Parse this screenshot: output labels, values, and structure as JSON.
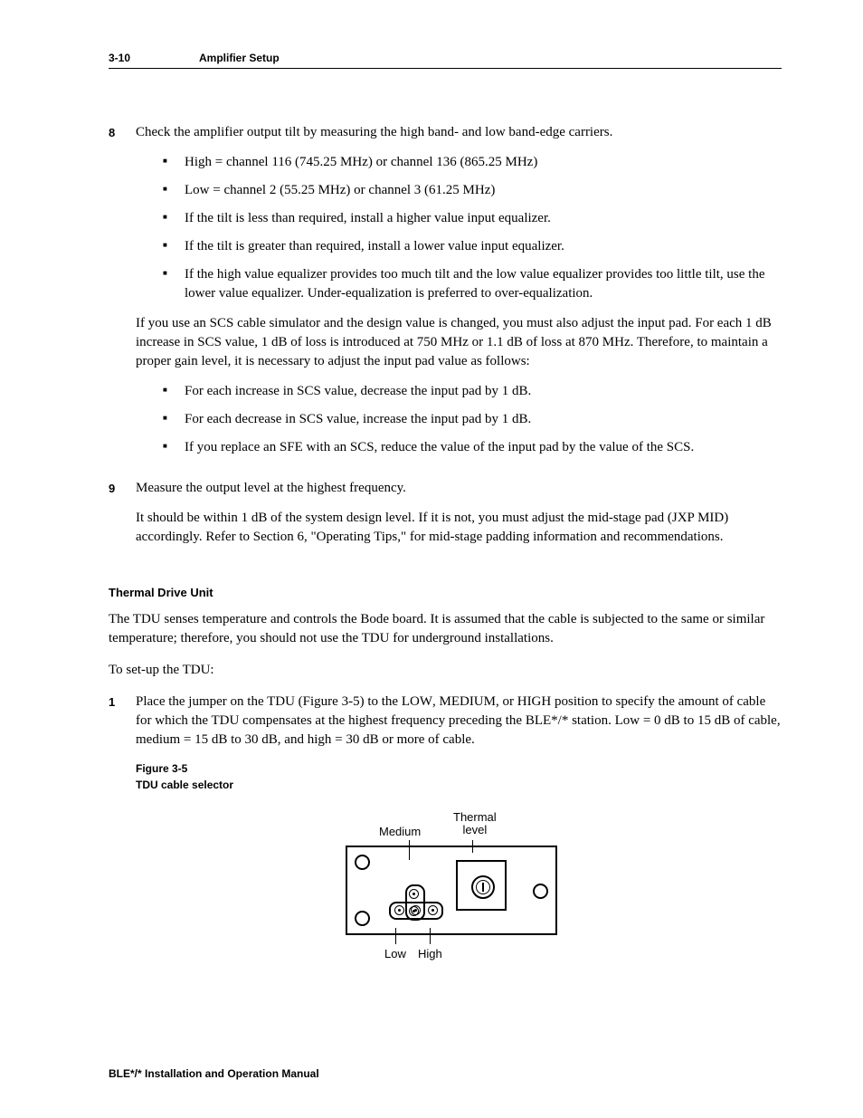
{
  "header": {
    "page_num": "3-10",
    "section_title": "Amplifier Setup"
  },
  "step8": {
    "num": "8",
    "intro": "Check the amplifier output tilt by measuring the high band- and low band-edge carriers.",
    "bullets": [
      "High = channel 116 (745.25 MHz) or channel 136 (865.25 MHz)",
      "Low = channel 2 (55.25 MHz) or channel 3 (61.25 MHz)",
      "If the tilt is less than required, install a higher value input equalizer.",
      "If the tilt is greater than required, install a lower value input equalizer.",
      "If the high value equalizer provides too much tilt and the low value equalizer provides too little tilt, use the lower value equalizer. Under-equalization is preferred to over-equalization."
    ],
    "para": "If you use an SCS cable simulator and the design value is changed, you must also adjust the input pad. For each 1 dB increase in SCS value, 1 dB of loss is introduced at 750 MHz or 1.1 dB of loss at 870 MHz. Therefore, to maintain a proper gain level, it is necessary to adjust the input pad value as follows:",
    "bullets2": [
      "For each increase in SCS value, decrease the input pad by 1 dB.",
      "For each decrease in SCS value, increase the input pad by 1 dB.",
      "If you replace an SFE with an SCS, reduce the value of the input pad by the value of the SCS."
    ]
  },
  "step9": {
    "num": "9",
    "intro": "Measure the output level at the highest frequency.",
    "para_pre": "It should be within 1 dB of the system design level. If it is not, you must adjust the mid-stage pad (",
    "para_sc": "JXP MID",
    "para_post": ") accordingly. Refer to Section 6, \"Operating Tips,\" for mid-stage padding information and recommendations."
  },
  "tdu": {
    "title": "Thermal Drive Unit",
    "para1": "The TDU senses temperature and controls the Bode board. It is assumed that the cable is subjected to the same or similar temperature; therefore, you should not use the TDU for underground installations.",
    "para2": "To set-up the TDU:"
  },
  "step1": {
    "num": "1",
    "pre": "Place the jumper on the TDU (Figure 3-5) to the ",
    "low": "LOW",
    "med": "MEDIUM",
    "or1": ", ",
    "or2": ", or ",
    "high": "HIGH",
    "post": " position to specify the amount of cable for which the TDU compensates at the highest frequency preceding the BLE*/* station. Low = 0 dB to 15 dB of cable, medium = 15 dB to 30 dB, and high = 30 dB or more of cable."
  },
  "figure": {
    "cap_line1": "Figure 3-5",
    "cap_line2": "TDU cable selector",
    "labels": {
      "medium": "Medium",
      "thermal": "Thermal\nlevel",
      "low": "Low",
      "high": "High"
    }
  },
  "footer": "BLE*/* Installation and Operation Manual"
}
